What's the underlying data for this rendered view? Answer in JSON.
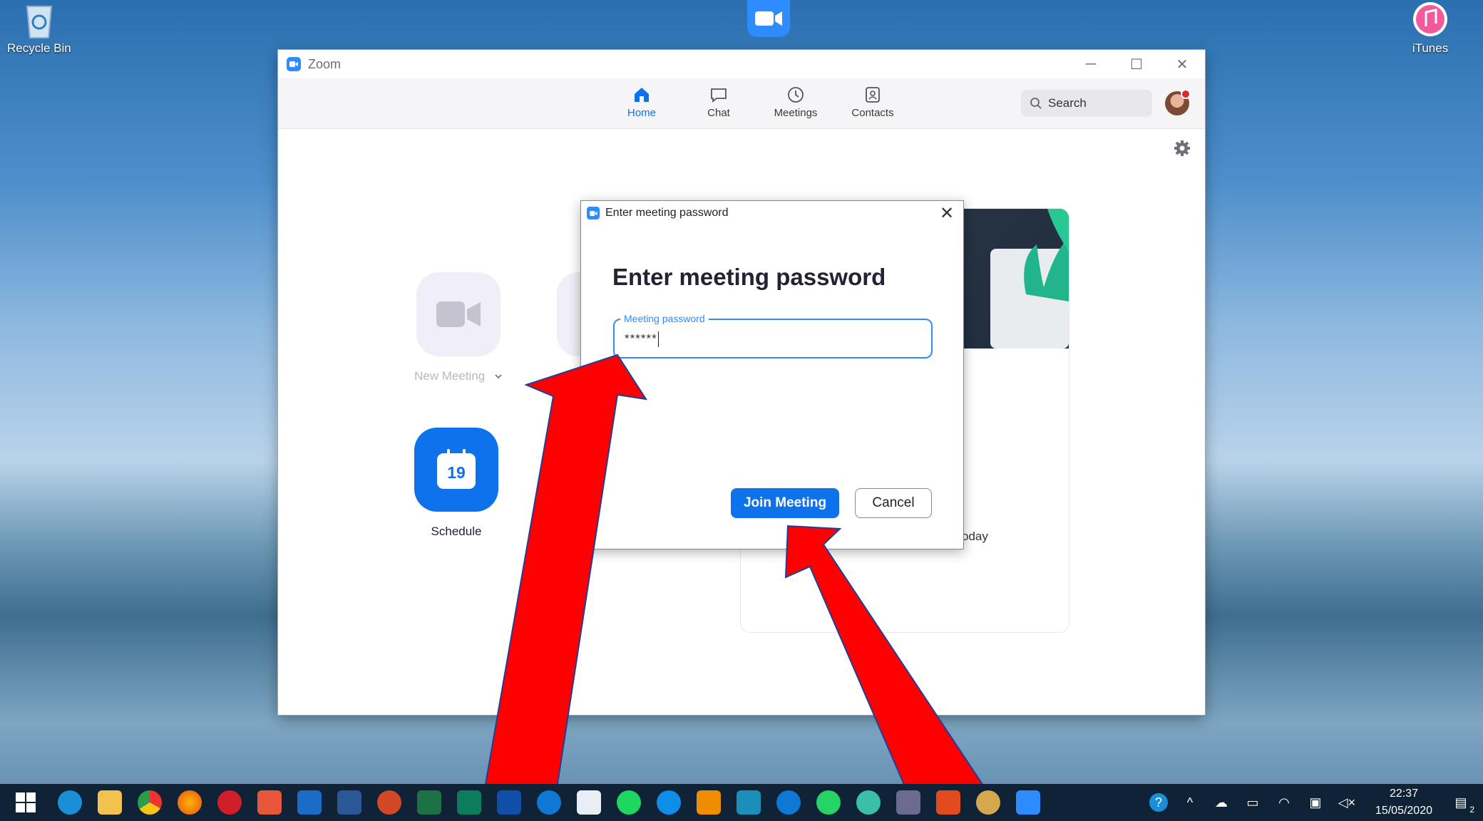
{
  "desktop": {
    "icons": [
      {
        "label": "Recycle Bin"
      },
      {
        "label": "iTunes"
      }
    ]
  },
  "window": {
    "title": "Zoom",
    "controls": {
      "minimize": "─",
      "maximize": "☐",
      "close": "✕"
    }
  },
  "nav": {
    "tabs": [
      {
        "label": "Home",
        "icon": "home-icon",
        "active": true
      },
      {
        "label": "Chat",
        "icon": "chat-icon"
      },
      {
        "label": "Meetings",
        "icon": "clock-icon"
      },
      {
        "label": "Contacts",
        "icon": "contacts-icon"
      }
    ],
    "search_placeholder": "Search"
  },
  "home": {
    "new_meeting_label": "New Meeting",
    "schedule_label": "Schedule",
    "calendar_day": "19",
    "card_partial_text": "oday"
  },
  "dialog": {
    "title": "Enter meeting password",
    "heading": "Enter meeting password",
    "field_label": "Meeting password",
    "field_value": "******",
    "join_label": "Join Meeting",
    "cancel_label": "Cancel",
    "close_glyph": "✕"
  },
  "taskbar": {
    "time": "22:37",
    "date": "15/05/2020",
    "notification_count": "2"
  },
  "colors": {
    "accent": "#0e72ed",
    "zoom_brand": "#2d8cff",
    "arrow": "#ff0000",
    "taskbar": "#102236"
  }
}
